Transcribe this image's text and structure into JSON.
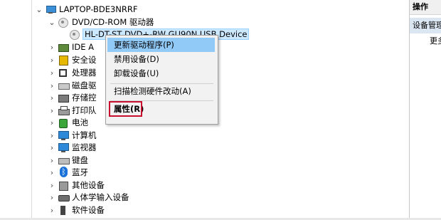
{
  "tree": {
    "computer": {
      "label": "LAPTOP-BDE3NRRF",
      "icon": "computer-icon"
    },
    "dvd_category": {
      "label": "DVD/CD-ROM 驱动器",
      "icon": "disc-drive-icon"
    },
    "dvd_device": {
      "label": "HL-DT-ST DVD+-RW GU90N USB Device",
      "icon": "disc-drive-icon"
    },
    "categories": [
      {
        "label": "IDE A",
        "icon": "ide-controller-icon"
      },
      {
        "label": "安全设",
        "icon": "security-device-icon"
      },
      {
        "label": "处理器",
        "icon": "processor-icon"
      },
      {
        "label": "磁盘驱",
        "icon": "disk-drive-icon"
      },
      {
        "label": "存储控",
        "icon": "storage-controller-icon"
      },
      {
        "label": "打印队",
        "icon": "print-queue-icon"
      },
      {
        "label": "电池",
        "icon": "battery-icon"
      },
      {
        "label": "计算机",
        "icon": "computer-icon"
      },
      {
        "label": "监视器",
        "icon": "monitor-icon"
      },
      {
        "label": "键盘",
        "icon": "keyboard-icon"
      },
      {
        "label": "蓝牙",
        "icon": "bluetooth-icon"
      },
      {
        "label": "其他设备",
        "icon": "other-devices-icon"
      },
      {
        "label": "人体学输入设备",
        "icon": "hid-icon"
      },
      {
        "label": "软件设备",
        "icon": "software-device-icon"
      }
    ],
    "expand_glyph": "›",
    "collapse_glyph": "⌄"
  },
  "context_menu": {
    "items": [
      {
        "label": "更新驱动程序(P)",
        "highlighted": true
      },
      {
        "label": "禁用设备(D)"
      },
      {
        "label": "卸载设备(U)"
      },
      {
        "label": "扫描检测硬件改动(A)"
      },
      {
        "label": "属性(R)",
        "bold": true,
        "outlined": true
      }
    ]
  },
  "actions_panel": {
    "header": "操作",
    "section": "设备管理器",
    "more": "更多操作"
  },
  "colors": {
    "menu_highlight": "#91c9f7",
    "outline_red": "#c8102e",
    "selection": "#cce8ff"
  }
}
